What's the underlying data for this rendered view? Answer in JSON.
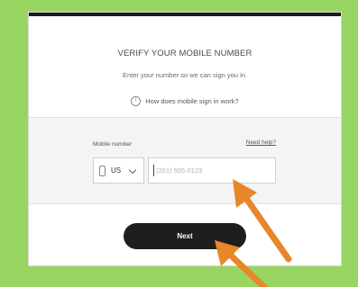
{
  "page": {
    "title": "VERIFY YOUR MOBILE NUMBER",
    "subtitle": "Enter your number so we can sign you in.",
    "help_link": "How does mobile sign in work?",
    "info_icon": "i"
  },
  "form": {
    "mobile_label": "Mobile number",
    "need_help": "Need help?",
    "country_code": "US",
    "phone_placeholder": "(201) 555-0123",
    "phone_value": ""
  },
  "actions": {
    "next_label": "Next"
  },
  "colors": {
    "background": "#98d562",
    "button": "#1f1d1d",
    "top_bar": "#1a1a1a",
    "arrow": "#e8862a"
  },
  "icons": {
    "info": "info-circle-icon",
    "phone": "phone-icon",
    "chevron": "chevron-down-icon",
    "arrow": "arrow-annotation-icon"
  }
}
